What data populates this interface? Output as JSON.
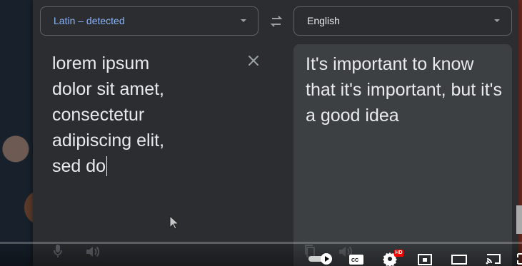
{
  "source_language": {
    "label": "Latin – detected"
  },
  "target_language": {
    "label": "English"
  },
  "input": {
    "text": "lorem ipsum\ndolor sit amet,\nconsectetur\nadipiscing elit,\nsed do"
  },
  "output": {
    "text": "It's important to know that it's important, but it's a good idea"
  },
  "icons": {
    "swap": "swap-icon",
    "clear": "close-icon",
    "microphone": "microphone-icon",
    "speaker": "speaker-icon",
    "copy": "copy-icon",
    "play": "play-icon",
    "captions": "captions-icon",
    "settings": "gear-icon",
    "hd_badge": "HD",
    "miniplayer": "miniplayer-icon",
    "theater": "theater-icon",
    "cast": "cast-icon",
    "fullscreen": "fullscreen-icon"
  },
  "colors": {
    "panel": "#2b2d30",
    "target_panel": "#3c4043",
    "text": "#e8eaed",
    "accent": "#8ab4f8",
    "icon": "#9aa0a6",
    "hd_badge": "#ff0000"
  }
}
